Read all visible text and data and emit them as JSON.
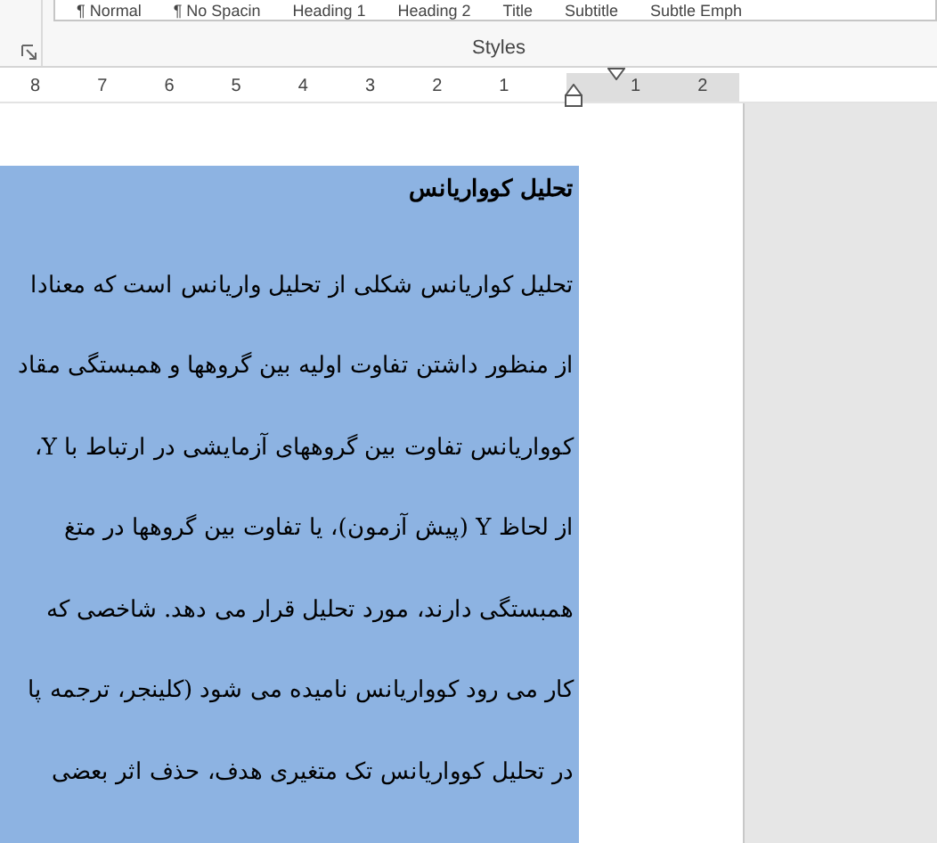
{
  "ribbon": {
    "styles": [
      "Subtle Emph",
      "Subtitle",
      "Title",
      "Heading 2",
      "Heading 1",
      "¶ No Spacin",
      "¶ Normal"
    ],
    "group_label": "Styles"
  },
  "ruler": {
    "left_marks": [
      "1",
      "2",
      "3",
      "4",
      "5",
      "6",
      "7",
      "8"
    ],
    "right_marks": [
      "2",
      "1"
    ]
  },
  "document": {
    "selected": true,
    "lines": [
      {
        "kind": "heading",
        "text": "تحلیل کوواریانس"
      },
      {
        "kind": "body",
        "text": "تحلیل کواریانس شکلی از تحلیل واریانس است که معنادا"
      },
      {
        "kind": "body",
        "text": "از منظور داشتن تفاوت اولیه بین گروهها و همبستگی مقاد"
      },
      {
        "kind": "body",
        "text": "کوواریانس تفاوت بین گروههای آزمایشی در ارتباط با Y،"
      },
      {
        "kind": "body",
        "text": "از لحاظ Y (پیش آزمون)، یا تفاوت بین گروهها در متغ"
      },
      {
        "kind": "body",
        "text": "همبستگی دارند، مورد تحلیل قرار می دهد. شاخصی که"
      },
      {
        "kind": "body",
        "text": "کار می رود کوواریانس نامیده می شود (کلینجر، ترجمه پا"
      },
      {
        "kind": "body",
        "text": "در تحلیل کوواریانس تک متغیری هدف، حذف اثر بعضی"
      }
    ]
  }
}
